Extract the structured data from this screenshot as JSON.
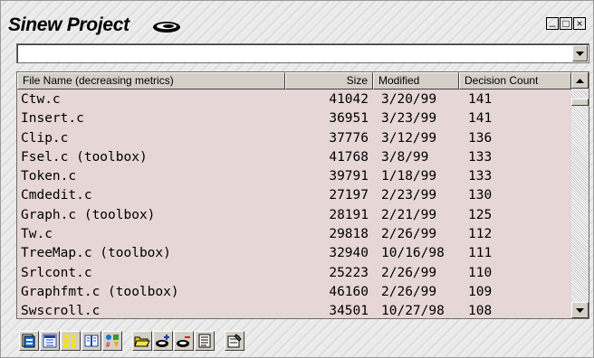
{
  "window": {
    "title": "Sinew Project",
    "controls": {
      "minimize": "_",
      "restore": "□",
      "close": "×"
    }
  },
  "path_dropdown": {
    "value": ""
  },
  "table": {
    "columns": {
      "name": "File Name (decreasing metrics)",
      "size": "Size",
      "modified": "Modified",
      "decision": "Decision Count"
    },
    "rows": [
      {
        "name": "Ctw.c",
        "size": "41042",
        "modified": "3/20/99",
        "decision": "141"
      },
      {
        "name": "Insert.c",
        "size": "36951",
        "modified": "3/23/99",
        "decision": "141"
      },
      {
        "name": "Clip.c",
        "size": "37776",
        "modified": "3/12/99",
        "decision": "136"
      },
      {
        "name": "Fsel.c (toolbox)",
        "size": "41768",
        "modified": "3/8/99",
        "decision": "133"
      },
      {
        "name": "Token.c",
        "size": "39791",
        "modified": "1/18/99",
        "decision": "133"
      },
      {
        "name": "Cmdedit.c",
        "size": "27197",
        "modified": "2/23/99",
        "decision": "130"
      },
      {
        "name": "Graph.c (toolbox)",
        "size": "28191",
        "modified": "2/21/99",
        "decision": "125"
      },
      {
        "name": "Tw.c",
        "size": "29818",
        "modified": "2/26/99",
        "decision": "112"
      },
      {
        "name": "TreeMap.c (toolbox)",
        "size": "32940",
        "modified": "10/16/98",
        "decision": "111"
      },
      {
        "name": "Srlcont.c",
        "size": "25223",
        "modified": "2/26/99",
        "decision": "110"
      },
      {
        "name": "Graphfmt.c (toolbox)",
        "size": "46160",
        "modified": "2/26/99",
        "decision": "109"
      },
      {
        "name": "Swscroll.c",
        "size": "34501",
        "modified": "10/27/98",
        "decision": "108"
      }
    ]
  },
  "scrollbar": {
    "position": 0.05
  },
  "toolbar": {
    "buttons": [
      {
        "icon": "file-view-icon"
      },
      {
        "icon": "detail-view-icon"
      },
      {
        "icon": "tile-view-icon"
      },
      {
        "icon": "book-view-icon"
      },
      {
        "icon": "metrics-icon"
      },
      {
        "icon": "open-folder-icon"
      },
      {
        "icon": "add-disk-icon"
      },
      {
        "icon": "remove-disk-icon"
      },
      {
        "icon": "list-icon"
      },
      {
        "icon": "properties-icon"
      }
    ]
  }
}
